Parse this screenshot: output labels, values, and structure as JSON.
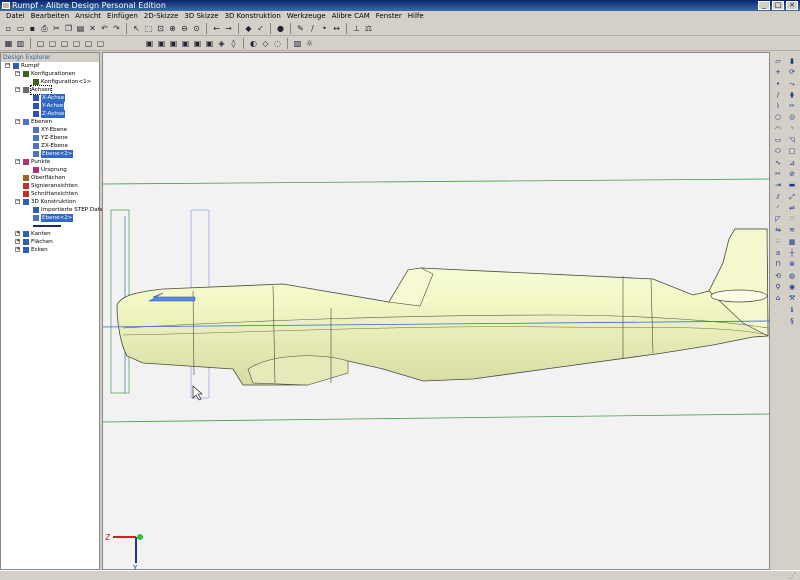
{
  "window": {
    "title": "Rumpf - Alibre Design Personal Edition"
  },
  "menu": [
    "Datei",
    "Bearbeiten",
    "Ansicht",
    "Einfügen",
    "2D-Skizze",
    "3D Skizze",
    "3D Konstruktion",
    "Werkzeuge",
    "Alibre CAM",
    "Fenster",
    "Hilfe"
  ],
  "explorer": {
    "title": "Design Explorer",
    "items": [
      {
        "label": "Rumpf",
        "level": 0,
        "expander": "−",
        "icon": "part-icon",
        "selected": false
      },
      {
        "label": "Konfigurationen",
        "level": 1,
        "expander": "−",
        "icon": "configurations-icon",
        "selected": false
      },
      {
        "label": "Konfiguration<1>",
        "level": 2,
        "expander": "",
        "icon": "configuration-icon",
        "selected": false
      },
      {
        "label": "Achsen",
        "level": 1,
        "expander": "−",
        "icon": "axes-icon",
        "selected": false,
        "outlined": true
      },
      {
        "label": "X-Achse",
        "level": 2,
        "expander": "",
        "icon": "axis-icon",
        "selected": true
      },
      {
        "label": "Y-Achse",
        "level": 2,
        "expander": "",
        "icon": "axis-icon",
        "selected": true
      },
      {
        "label": "Z-Achse",
        "level": 2,
        "expander": "",
        "icon": "axis-icon",
        "selected": true
      },
      {
        "label": "Ebenen",
        "level": 1,
        "expander": "−",
        "icon": "planes-icon",
        "selected": false
      },
      {
        "label": "XY-Ebene",
        "level": 2,
        "expander": "",
        "icon": "plane-icon",
        "selected": false
      },
      {
        "label": "YZ-Ebene",
        "level": 2,
        "expander": "",
        "icon": "plane-icon",
        "selected": false
      },
      {
        "label": "ZX-Ebene",
        "level": 2,
        "expander": "",
        "icon": "plane-icon",
        "selected": false
      },
      {
        "label": "Ebene<2>",
        "level": 2,
        "expander": "",
        "icon": "plane-icon",
        "selected": true
      },
      {
        "label": "Punkte",
        "level": 1,
        "expander": "−",
        "icon": "points-icon",
        "selected": false
      },
      {
        "label": "Ursprung",
        "level": 2,
        "expander": "",
        "icon": "origin-icon",
        "selected": false
      },
      {
        "label": "Oberflächen",
        "level": 1,
        "expander": "",
        "icon": "surfaces-icon",
        "selected": false
      },
      {
        "label": "Signieransichten",
        "level": 1,
        "expander": "",
        "icon": "views-icon",
        "selected": false
      },
      {
        "label": "Schnittansichten",
        "level": 1,
        "expander": "",
        "icon": "section-views-icon",
        "selected": false
      },
      {
        "label": "3D Konstruktion",
        "level": 1,
        "expander": "−",
        "icon": "construction-icon",
        "selected": false
      },
      {
        "label": "Importierte STEP Datei",
        "level": 2,
        "expander": "",
        "icon": "import-icon",
        "selected": false
      },
      {
        "label": "Ebene<2>",
        "level": 2,
        "expander": "",
        "icon": "plane-icon",
        "selected": true
      },
      {
        "label": "",
        "level": 2,
        "expander": "",
        "icon": "rollback-bar-icon",
        "selected": false
      },
      {
        "label": "Kanten",
        "level": 1,
        "expander": "+",
        "icon": "edges-icon",
        "selected": false
      },
      {
        "label": "Flächen",
        "level": 1,
        "expander": "+",
        "icon": "faces-icon",
        "selected": false
      },
      {
        "label": "Ecken",
        "level": 1,
        "expander": "+",
        "icon": "vertices-icon",
        "selected": false
      }
    ]
  },
  "toolbar_row1": [
    "new-icon",
    "open-icon",
    "save-icon",
    "print-icon",
    "cut-icon",
    "copy-icon",
    "paste-icon",
    "delete-icon",
    "undo-icon",
    "redo-icon",
    "sep",
    "select-icon",
    "select-box-icon",
    "zoom-fit-icon",
    "zoom-in-icon",
    "zoom-out-icon",
    "zoom-window-icon",
    "sep",
    "previous-view-icon",
    "next-view-icon",
    "sep",
    "feature-icon",
    "check-icon",
    "sep",
    "render-icon",
    "sep",
    "sketch-icon",
    "line-icon",
    "point-icon",
    "measure-icon",
    "sep",
    "dimension-icon",
    "balance-icon"
  ],
  "toolbar_row2": [
    "orient-icon",
    "section-icon",
    "sep",
    "view1-icon",
    "view2-icon",
    "view3-icon",
    "view4-icon",
    "view5-icon",
    "view6-icon",
    "gap",
    "cube-front-icon",
    "cube-back-icon",
    "cube-top-icon",
    "cube-bottom-icon",
    "cube-left-icon",
    "cube-right-icon",
    "cube-iso-icon",
    "cube-normal-icon",
    "sep",
    "shade-icon",
    "wire-icon",
    "hidden-icon",
    "sep",
    "display-icon",
    "bulb-icon"
  ],
  "right_toolbar_col1": [
    "sketch-plane-icon",
    "plus-icon",
    "point-icon",
    "line-icon",
    "polyline-icon",
    "circle-icon",
    "arc-icon",
    "rectangle-icon",
    "ellipse-icon",
    "spline-icon",
    "trim-icon",
    "extend-icon",
    "offset-icon",
    "fillet-icon",
    "chamfer-icon",
    "mirror-icon",
    "pattern-icon",
    "text-icon",
    "project-icon",
    "convert-icon",
    "figure-icon",
    "ref-icon"
  ],
  "right_toolbar_col2": [
    "extrude-icon",
    "revolve-icon",
    "sweep-icon",
    "loft-icon",
    "cut-icon",
    "hole-icon",
    "fillet3d-icon",
    "chamfer3d-icon",
    "shell-icon",
    "draft-icon",
    "split-icon",
    "thicken-icon",
    "scale-icon",
    "mirror3d-icon",
    "pattern3d-icon",
    "thread-icon",
    "emboss-icon",
    "rib-icon",
    "boolean-icon",
    "globe-icon",
    "orange-icon",
    "tools-icon",
    "info-icon",
    "helix-icon"
  ],
  "viewport": {
    "triad": {
      "x_label": "Z",
      "y_label": "Y"
    }
  },
  "colors": {
    "fuselage_fill": "#f2f7c7",
    "fuselage_edge": "#4a4a3a",
    "plane_lines": "#4a9a4a",
    "axis_line": "#2a6adf",
    "selection": "#316ac5",
    "title_bg": "#0a246a"
  }
}
